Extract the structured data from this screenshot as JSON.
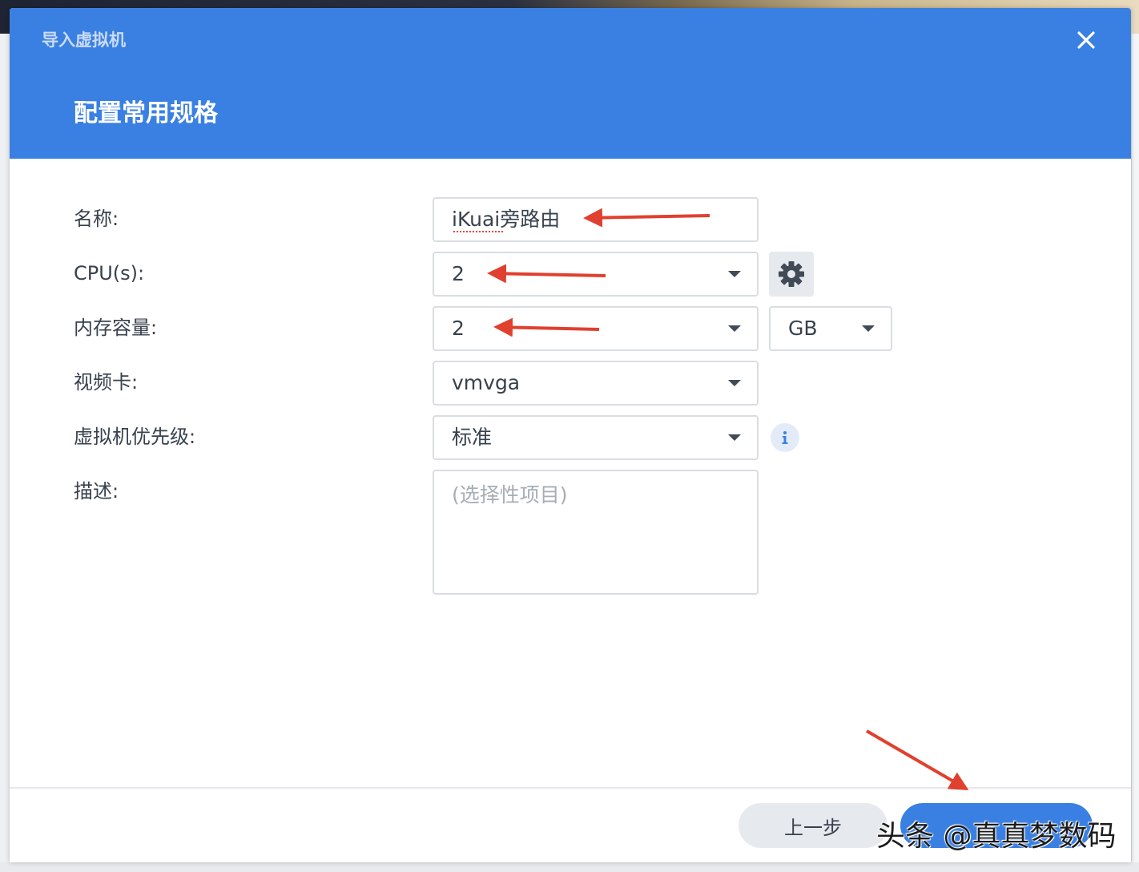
{
  "dialog": {
    "window_title": "导入虚拟机",
    "step_title": "配置常用规格",
    "close_icon": "close-icon"
  },
  "form": {
    "name": {
      "label": "名称:",
      "value": "iKuai旁路由"
    },
    "cpu": {
      "label": "CPU(s):",
      "value": "2",
      "settings_icon": "gear-icon"
    },
    "memory": {
      "label": "内存容量:",
      "value": "2",
      "unit": "GB"
    },
    "video_card": {
      "label": "视频卡:",
      "value": "vmvga"
    },
    "priority": {
      "label": "虚拟机优先级:",
      "value": "标准",
      "info_icon": "info-icon"
    },
    "description": {
      "label": "描述:",
      "placeholder": "(选择性项目)"
    }
  },
  "footer": {
    "prev_label": "上一步",
    "next_label": ""
  },
  "watermark": "头条 @真真梦数码",
  "colors": {
    "header_bg": "#3a80e2",
    "annotation_arrow": "#e0402f",
    "label_text": "#38414d"
  }
}
